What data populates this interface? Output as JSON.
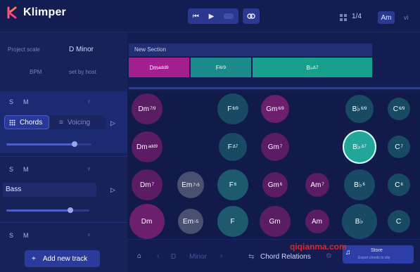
{
  "app": {
    "name": "Klimper"
  },
  "topbar": {
    "meter": "1/4",
    "mode_active": "Am",
    "mode_other": "vi"
  },
  "project": {
    "scale_label": "Project scale",
    "scale_value": "D Minor",
    "bpm_label": "BPM",
    "bpm_value": "set by host"
  },
  "tracks": [
    {
      "s": "S",
      "m": "M",
      "tabs": [
        "Chords",
        "Voicing"
      ],
      "volume": 0.8
    },
    {
      "s": "S",
      "m": "M",
      "name": "Bass",
      "volume": 0.77
    },
    {
      "s": "S",
      "m": "M"
    }
  ],
  "add_track_label": "Add new track",
  "timeline": {
    "section_name": "New Section",
    "blocks": [
      {
        "root": "Dm",
        "sup": "add9",
        "color": "#a31e8e"
      },
      {
        "root": "F",
        "sup": "6/9",
        "color": "#1a8a8a"
      },
      {
        "root": "B♭",
        "sup": "Δ7",
        "color": "#19a08c"
      }
    ]
  },
  "chord_grid": [
    {
      "root": "Dm",
      "sup": "7/9",
      "style": "dpurple"
    },
    {
      "root": "F",
      "sup": "6/9",
      "style": "dteal"
    },
    {
      "root": "Gm",
      "sup": "6/9",
      "style": "purple"
    },
    {
      "root": "B♭",
      "sup": "6/9",
      "style": "dteal"
    },
    {
      "root": "C",
      "sup": "6/9",
      "style": "dteal"
    },
    {
      "root": "Dm",
      "sup": "add9",
      "style": "dpurple"
    },
    {
      "root": "F",
      "sup": "Δ7",
      "style": "dteal"
    },
    {
      "root": "Gm",
      "sup": "7",
      "style": "dpurple"
    },
    {
      "root": "B♭",
      "sup": "Δ7",
      "style": "bright"
    },
    {
      "root": "C",
      "sup": "7",
      "style": "dteal"
    },
    {
      "root": "Dm",
      "sup": "7",
      "style": "dpurple"
    },
    {
      "root": "Em",
      "sup": "7♭5",
      "style": "gray"
    },
    {
      "root": "F",
      "sup": "6",
      "style": "teal"
    },
    {
      "root": "Gm",
      "sup": "6",
      "style": "dpurple"
    },
    {
      "root": "Am",
      "sup": "7",
      "style": "dpurple"
    },
    {
      "root": "B♭",
      "sup": "6",
      "style": "dteal"
    },
    {
      "root": "C",
      "sup": "6",
      "style": "dteal"
    },
    {
      "root": "Dm",
      "sup": "",
      "style": "purple"
    },
    {
      "root": "Em",
      "sup": "♭5",
      "style": "gray"
    },
    {
      "root": "F",
      "sup": "",
      "style": "teal"
    },
    {
      "root": "Gm",
      "sup": "",
      "style": "dpurple"
    },
    {
      "root": "Am",
      "sup": "",
      "style": "dpurple"
    },
    {
      "root": "B♭",
      "sup": "",
      "style": "dteal"
    },
    {
      "root": "C",
      "sup": "",
      "style": "dteal"
    }
  ],
  "bottom": {
    "key_root": "D",
    "key_mode": "Minor",
    "relations_label": "Chord Relations",
    "store_label": "Store",
    "store_sub": "Export chords to clip"
  },
  "watermark": "qiqianma.com"
}
